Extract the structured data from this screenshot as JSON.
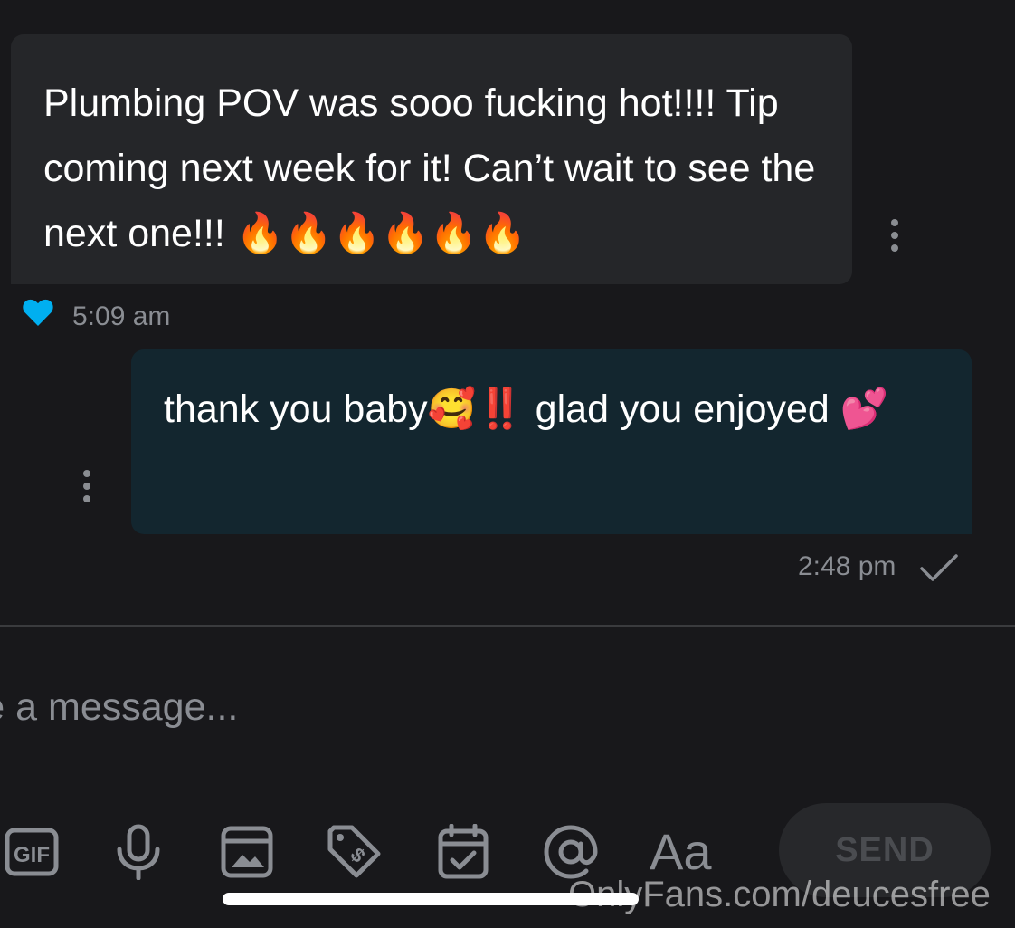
{
  "messages": [
    {
      "direction": "incoming",
      "text": "Plumbing POV was sooo fucking hot!!!! Tip coming next week for it! Can’t wait to see the next one!!! 🔥🔥🔥🔥🔥🔥",
      "time": "5:09 am",
      "liked": true
    },
    {
      "direction": "outgoing",
      "text": "thank you baby🥰‼️ glad you enjoyed 💕",
      "time": "2:48 pm",
      "status": "sent"
    }
  ],
  "composer": {
    "placeholder": "Type a message...",
    "send_label": "SEND",
    "format_label": "Aa",
    "icons": [
      "gif-icon",
      "microphone-icon",
      "image-icon",
      "price-tag-icon",
      "calendar-icon",
      "mention-icon",
      "text-format-icon"
    ]
  },
  "watermark": "OnlyFans.com/deucesfree",
  "colors": {
    "background": "#18181b",
    "incoming_bubble": "#252629",
    "outgoing_bubble": "#13262f",
    "like_heart": "#00aff0",
    "muted_text": "#8a8d93"
  }
}
